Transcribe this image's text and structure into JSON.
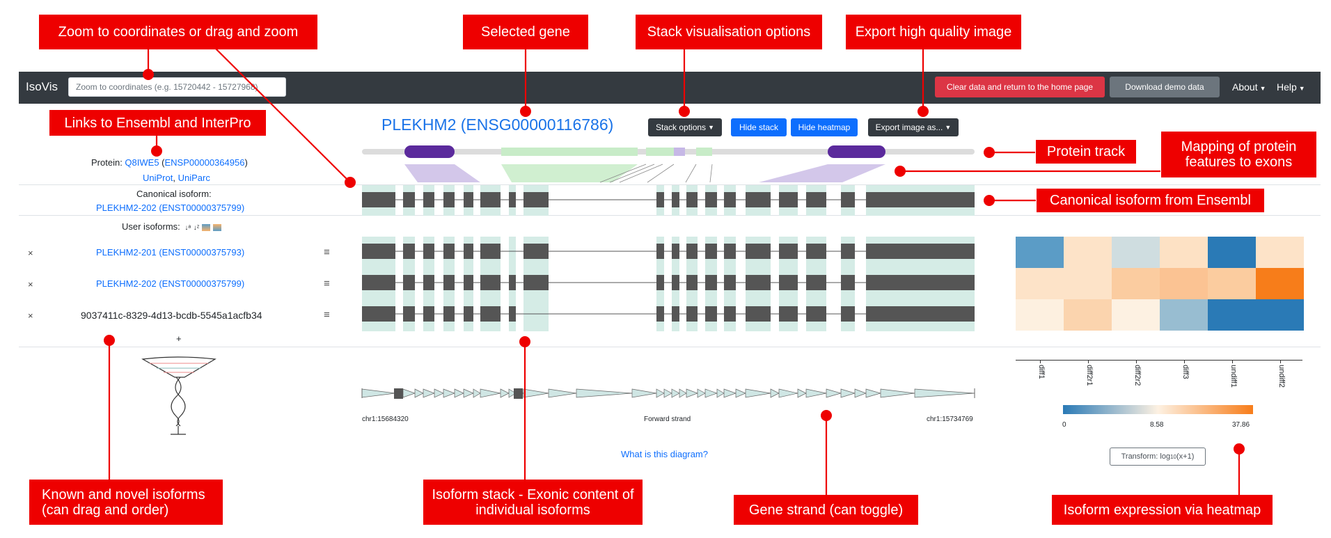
{
  "navbar": {
    "brand": "IsoVis",
    "search_placeholder": "Zoom to coordinates (e.g. 15720442 - 15727968)",
    "clear_label": "Clear data and return to the home page",
    "demo_label": "Download demo data",
    "about_label": "About",
    "help_label": "Help"
  },
  "gene": {
    "title": "PLEKHM2 (ENSG00000116786)",
    "stack_options": "Stack options",
    "hide_stack": "Hide stack",
    "hide_heatmap": "Hide heatmap",
    "export_image": "Export image as..."
  },
  "protein": {
    "label": "Protein: ",
    "uniprot_id": "Q8IWE5",
    "ensembl_id": "ENSP00000364956",
    "uniprot_link": "UniProt",
    "uniparc_link": "UniParc"
  },
  "canonical": {
    "label": "Canonical isoform:",
    "isoform": "PLEKHM2-202 (ENST00000375799)"
  },
  "user_isoforms": {
    "label": "User isoforms:",
    "rows": [
      {
        "remove": "×",
        "name": "PLEKHM2-201 (ENST00000375793)",
        "handle": "≡",
        "is_link": true
      },
      {
        "remove": "×",
        "name": "PLEKHM2-202 (ENST00000375799)",
        "handle": "≡",
        "is_link": true
      },
      {
        "remove": "×",
        "name": "9037411c-8329-4d13-bcdb-5545a1acfb34",
        "handle": "≡",
        "is_link": false
      }
    ],
    "add": "+"
  },
  "strand": {
    "left_coord": "chr1:15684320",
    "center": "Forward strand",
    "right_coord": "chr1:15734769"
  },
  "help_link": "What is this diagram?",
  "heatmap": {
    "columns": [
      "diff1",
      "diff2r1",
      "diff2r2",
      "diff3",
      "undiff1",
      "undiff2"
    ],
    "colors": [
      [
        "#5b9cc6",
        "#fde3c8",
        "#cfdde0",
        "#fde1c4",
        "#2a7ab6",
        "#fde3c8"
      ],
      [
        "#fde3c8",
        "#fde3c8",
        "#fbcca0",
        "#fbc393",
        "#fbcc9f",
        "#f77d1a"
      ],
      [
        "#fdf0e0",
        "#fbd4ae",
        "#fdf1e2",
        "#98bdd1",
        "#2a7ab6",
        "#2a7ab6"
      ]
    ],
    "scale_min": "0",
    "scale_mid": "8.58",
    "scale_max": "37.86",
    "transform_prefix": "Transform: log",
    "transform_sub": "10",
    "transform_suffix": "(x+1)"
  },
  "callouts": {
    "zoom": "Zoom to coordinates or drag and zoom",
    "selected_gene": "Selected gene",
    "stack_vis": "Stack visualisation options",
    "export": "Export high quality image",
    "links": "Links to Ensembl and InterPro",
    "protein_track": "Protein track",
    "mapping": "Mapping of protein features to exons",
    "canonical": "Canonical isoform from Ensembl",
    "known_novel": "Known and novel isoforms (can drag and order)",
    "isoform_stack": "Isoform stack - Exonic content of individual isoforms",
    "gene_strand": "Gene strand (can toggle)",
    "heatmap": "Isoform expression via heatmap"
  },
  "colors": {
    "callout_red": "#ee0000",
    "navbar_dark": "#343a40",
    "link_blue": "#0d6efd",
    "exon_dark": "#555555",
    "exon_shade": "#d5ece6",
    "domain_purple": "#5b2a9c",
    "domain_green": "#c8ecc8"
  }
}
